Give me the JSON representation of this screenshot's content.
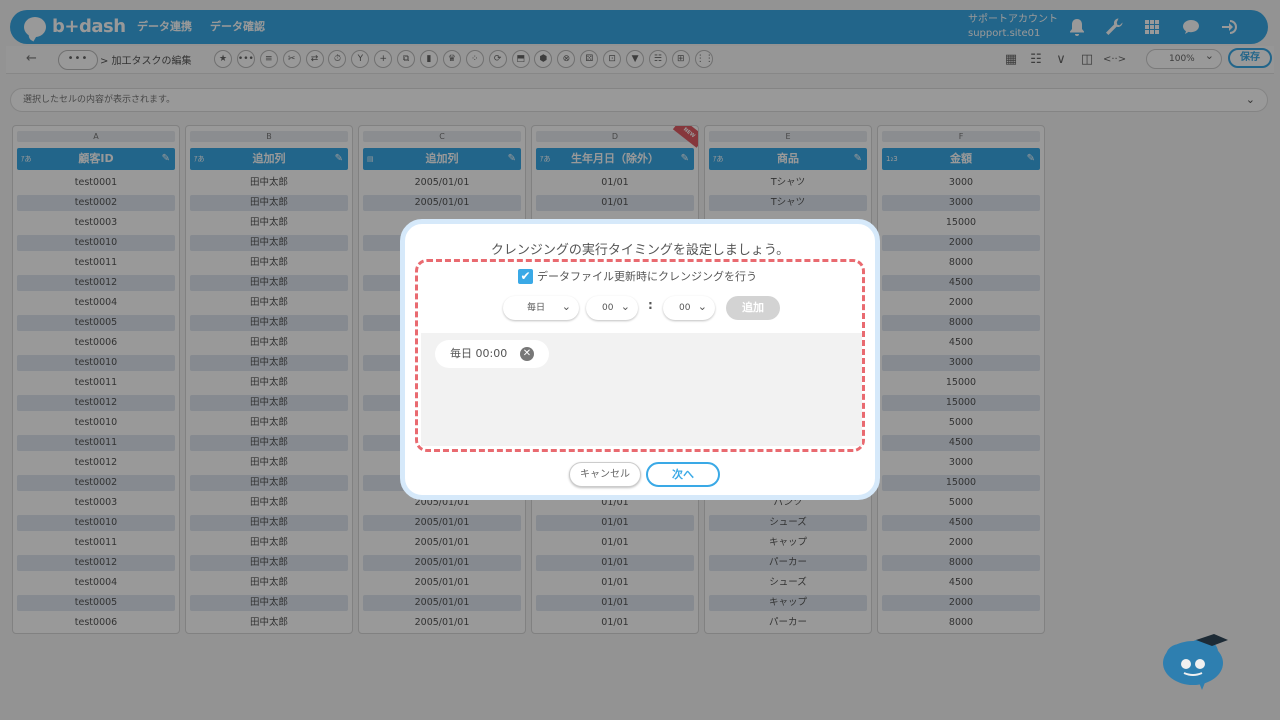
{
  "app": {
    "logo_text": "b+dash"
  },
  "nav": [
    "データ連携",
    "データ確認"
  ],
  "account": {
    "name": "サポートアカウント",
    "site": "support.site01"
  },
  "toolbar": {
    "more": "•••",
    "breadcrumb": "> 加工タスクの編集",
    "icons": [
      "★",
      "•••",
      "≡",
      "✂",
      "⇄",
      "⏱",
      "Y",
      "+",
      "⧉",
      "▮",
      "♛",
      "⁘",
      "⟳",
      "⬒",
      "⬢",
      "⊗",
      "⚄",
      "⊡",
      "▼",
      "☵",
      "⊞",
      "⋮⋮"
    ],
    "zoom": "100%",
    "save_label": "保存"
  },
  "cellbar": {
    "text": "選択したセルの内容が表示されます。"
  },
  "sheet": {
    "columns": [
      {
        "letter": "A",
        "type": "ｱあ",
        "name": "顧客ID",
        "cells": [
          "test0001",
          "test0002",
          "test0003",
          "test0010",
          "test0011",
          "test0012",
          "test0004",
          "test0005",
          "test0006",
          "test0010",
          "test0011",
          "test0012",
          "test0010",
          "test0011",
          "test0012",
          "test0002",
          "test0003",
          "test0010",
          "test0011",
          "test0012",
          "test0004",
          "test0005",
          "test0006"
        ]
      },
      {
        "letter": "B",
        "type": "ｱあ",
        "name": "追加列",
        "cells": [
          "田中太郎",
          "田中太郎",
          "田中太郎",
          "田中太郎",
          "田中太郎",
          "田中太郎",
          "田中太郎",
          "田中太郎",
          "田中太郎",
          "田中太郎",
          "田中太郎",
          "田中太郎",
          "田中太郎",
          "田中太郎",
          "田中太郎",
          "田中太郎",
          "田中太郎",
          "田中太郎",
          "田中太郎",
          "田中太郎",
          "田中太郎",
          "田中太郎",
          "田中太郎"
        ]
      },
      {
        "letter": "C",
        "type": "▤",
        "name": "追加列",
        "cells": [
          "2005/01/01",
          "2005/01/01",
          "",
          "",
          "",
          "",
          "",
          "",
          "",
          "",
          "",
          "",
          "",
          "",
          "",
          "",
          "2005/01/01",
          "2005/01/01",
          "2005/01/01",
          "2005/01/01",
          "2005/01/01",
          "2005/01/01",
          "2005/01/01"
        ]
      },
      {
        "letter": "D",
        "type": "ｱあ",
        "name": "生年月日（除外）",
        "badge": "NEW",
        "cells": [
          "01/01",
          "01/01",
          "",
          "",
          "",
          "",
          "",
          "",
          "",
          "",
          "",
          "",
          "",
          "",
          "",
          "",
          "01/01",
          "01/01",
          "01/01",
          "01/01",
          "01/01",
          "01/01",
          "01/01"
        ]
      },
      {
        "letter": "E",
        "type": "ｱあ",
        "name": "商品",
        "cells": [
          "Tシャツ",
          "Tシャツ",
          "",
          "",
          "",
          "",
          "",
          "",
          "",
          "",
          "",
          "",
          "",
          "",
          "",
          "",
          "パンツ",
          "シューズ",
          "キャップ",
          "パーカー",
          "シューズ",
          "キャップ",
          "パーカー"
        ]
      },
      {
        "letter": "F",
        "type": "1₂3",
        "name": "金額",
        "cells": [
          "3000",
          "3000",
          "15000",
          "2000",
          "8000",
          "4500",
          "2000",
          "8000",
          "4500",
          "3000",
          "15000",
          "15000",
          "5000",
          "4500",
          "3000",
          "15000",
          "5000",
          "4500",
          "2000",
          "8000",
          "4500",
          "2000",
          "8000"
        ]
      }
    ]
  },
  "modal": {
    "title": "クレンジングの実行タイミングを設定しましょう。",
    "checkbox_label": "データファイル更新時にクレンジングを行う",
    "checkbox_mark": "✔",
    "frequency": "毎日",
    "hour": "00",
    "minute": "00",
    "colon": ":",
    "add_label": "追加",
    "schedules": [
      "毎日 00:00"
    ],
    "remove_mark": "✕",
    "cancel_label": "キャンセル",
    "next_label": "次へ"
  },
  "colors": {
    "accent": "#3aa9e6",
    "dash": "#e96a70",
    "alt_row": "#dfe7f1"
  }
}
